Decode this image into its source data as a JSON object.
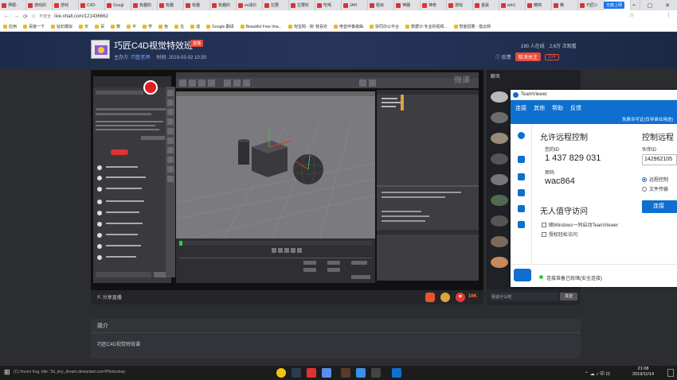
{
  "browser": {
    "tabs": [
      "押顺-",
      "游戏的",
      "游戏",
      "C4D-",
      "Googl",
      "有趣的",
      "有趣",
      "有趣",
      "有趣的",
      "ev减价",
      "拉要",
      "拉要叹",
      "吃喝",
      "JAH",
      "题目",
      "神器",
      "神奇",
      "游戏",
      "金属",
      "win1",
      "精简",
      "精",
      "巧匠"
    ],
    "active_tab_title": "巧匠C4",
    "window_controls": [
      "‒",
      "▢",
      "✕"
    ],
    "new_tab": "+",
    "url_security": "不安全",
    "url": "live.xhall.com/121436662",
    "bookmarks": [
      "应用",
      "百度一下",
      "钻石模拟",
      "天",
      "百",
      "数",
      "平",
      "学",
      "色",
      "在",
      "成",
      "Google 翻译",
      "Beautiful Free Ima...",
      "淘宝网 - 淘! 我喜欢",
      "电音伴奏歌曲",
      "协同办公平台",
      "数据计:专业的视频...",
      "智能招聘 - 猎云网"
    ],
    "profile_badge": "无痕上网"
  },
  "room": {
    "title": "巧匠C4D视觉特效班",
    "live_badge": "直播",
    "anchor_label": "主办方:",
    "anchor_name": "巧匠老师",
    "time_label": "时间:",
    "time_value": "2019-03-02 10:30",
    "online": "190 人在线",
    "views": "2.6万 次观看",
    "feedback": "反馈",
    "follow": "取消关注",
    "follow_count": "104"
  },
  "player": {
    "share_label": "分享直播",
    "gift_count": "16K",
    "watermark": "微课"
  },
  "chat": {
    "header": "聊天",
    "placeholder": "我说什么吧",
    "send": "发送"
  },
  "intro": {
    "heading": "简介",
    "text": "巧匠C4D视觉特效课"
  },
  "teamviewer": {
    "title": "TeamViewer",
    "menu": [
      "连接",
      "其他",
      "帮助",
      "反馈"
    ],
    "free_notice": "免费许可证(仅非商业用途)",
    "allow_heading": "允许远程控制",
    "your_id_label": "您的ID",
    "your_id": "1 437 829 031",
    "password_label": "密码",
    "password": "wac864",
    "unattended_heading": "无人值守访问",
    "start_with_windows": "随Windows一同启动TeamViewer",
    "grant_easy_access": "授权轻松访问",
    "control_heading": "控制远程",
    "partner_id_label": "伙伴ID",
    "partner_id": "142962105",
    "opt_remote": "远程控制",
    "opt_file": "文件传输",
    "connect_button": "连接",
    "status": "连接准备已就绪(安全连接)"
  },
  "taskbar": {
    "status_text": "(C) frozen frog, title: '3d_tiny_dream.deviantart.com'/Photoshop",
    "time": "21:08",
    "date": "2019/11/14"
  },
  "colors": {
    "accent_blue": "#0e6fcf",
    "live_red": "#e74c3c"
  }
}
